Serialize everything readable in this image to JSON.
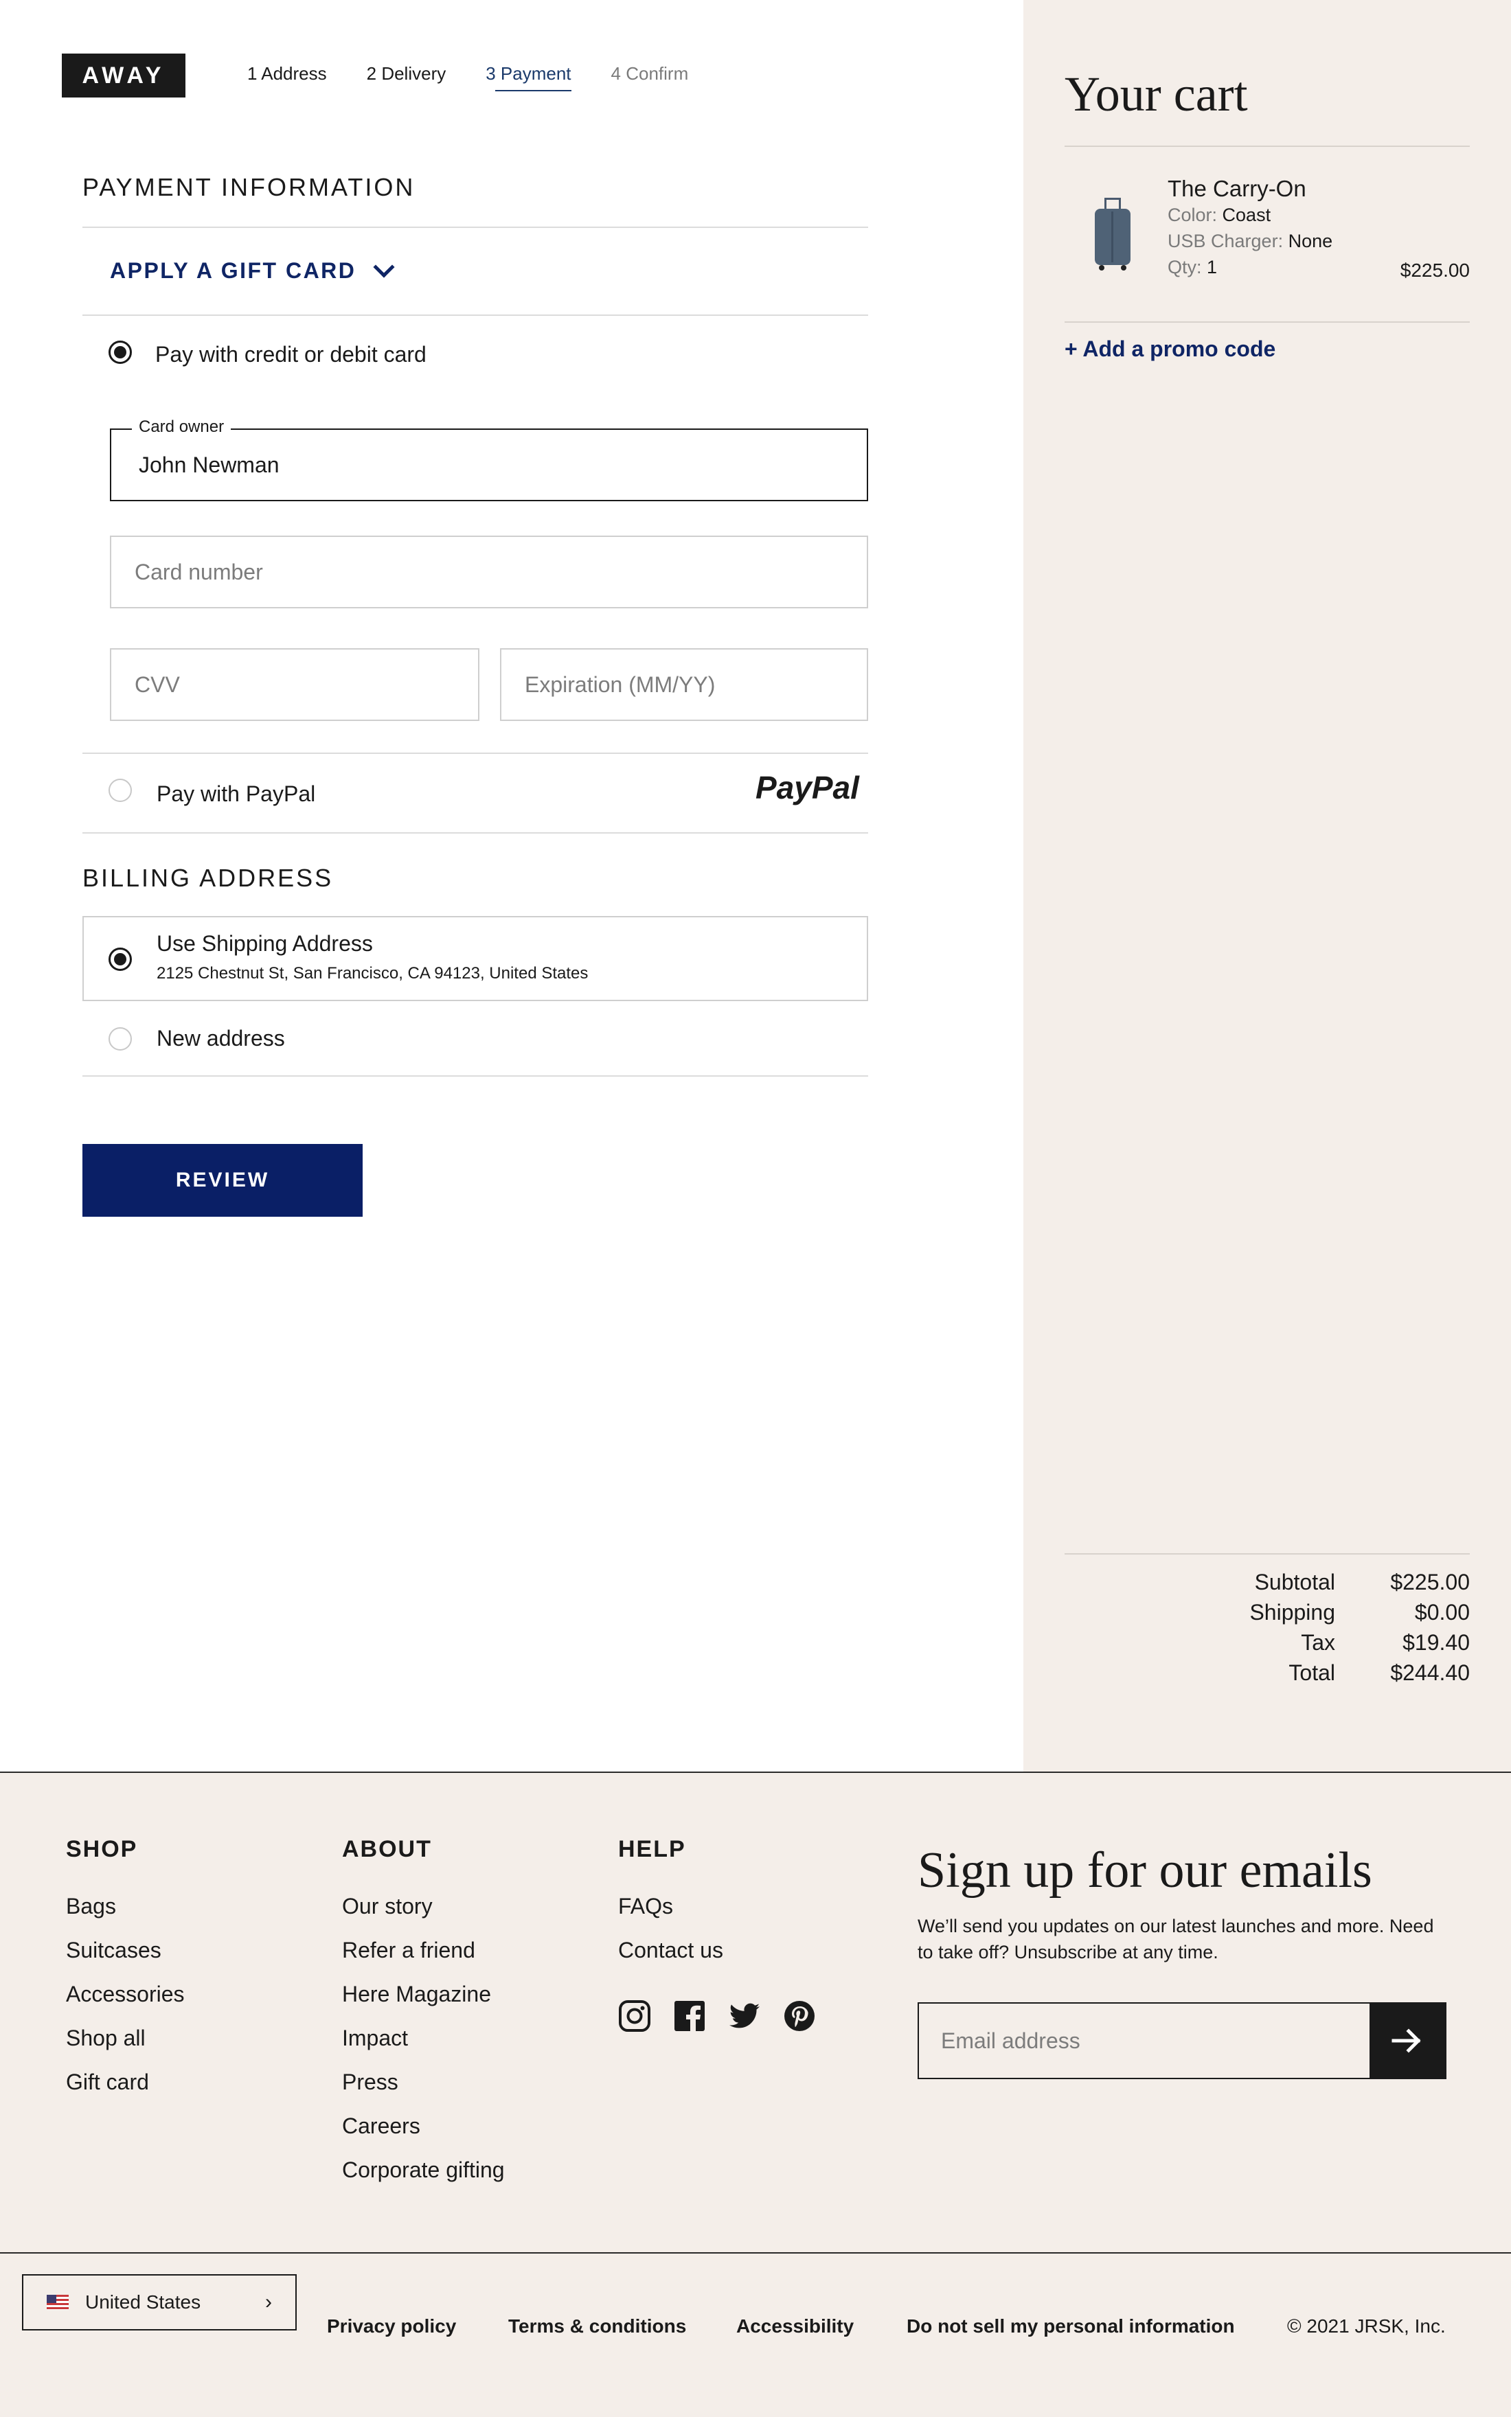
{
  "brand": {
    "logo": "AWAY"
  },
  "steps": [
    {
      "label": "1 Address",
      "state": "done"
    },
    {
      "label": "2 Delivery",
      "state": "done"
    },
    {
      "label": "3 Payment",
      "state": "active"
    },
    {
      "label": "4 Confirm",
      "state": "upcoming"
    }
  ],
  "payment": {
    "title": "PAYMENT INFORMATION",
    "gift_card_label": "APPLY A GIFT CARD",
    "credit_option": {
      "label": "Pay with credit or debit card",
      "selected": true
    },
    "card_owner": {
      "label": "Card owner",
      "value": "John Newman"
    },
    "card_number": {
      "placeholder": "Card number"
    },
    "cvv": {
      "placeholder": "CVV"
    },
    "expiration": {
      "placeholder": "Expiration (MM/YY)"
    },
    "paypal_option": {
      "label": "Pay with PayPal",
      "logo": "PayPal",
      "selected": false
    }
  },
  "billing": {
    "title": "BILLING ADDRESS",
    "shipping_option": {
      "label": "Use Shipping Address",
      "address": "2125 Chestnut St, San Francisco, CA 94123, United States",
      "selected": true
    },
    "new_option": {
      "label": "New address",
      "selected": false
    }
  },
  "review_button": "REVIEW",
  "cart": {
    "title": "Your cart",
    "item": {
      "name": "The Carry-On",
      "color_label": "Color:",
      "color_value": "Coast",
      "usb_label": "USB Charger:",
      "usb_value": "None",
      "qty_label": "Qty:",
      "qty_value": "1",
      "price": "$225.00"
    },
    "promo_link": "+ Add a promo code",
    "totals": [
      {
        "label": "Subtotal",
        "value": "$225.00"
      },
      {
        "label": "Shipping",
        "value": "$0.00"
      },
      {
        "label": "Tax",
        "value": "$19.40"
      },
      {
        "label": "Total",
        "value": "$244.40"
      }
    ]
  },
  "footer": {
    "shop": {
      "title": "SHOP",
      "links": [
        "Bags",
        "Suitcases",
        "Accessories",
        "Shop all",
        "Gift card"
      ]
    },
    "about": {
      "title": "ABOUT",
      "links": [
        "Our story",
        "Refer a friend",
        "Here Magazine",
        "Impact",
        "Press",
        "Careers",
        "Corporate gifting"
      ]
    },
    "help": {
      "title": "HELP",
      "links": [
        "FAQs",
        "Contact us"
      ]
    },
    "social_icons": [
      "instagram-icon",
      "facebook-icon",
      "twitter-icon",
      "pinterest-icon"
    ],
    "signup": {
      "title": "Sign up for our emails",
      "text": "We’ll send you updates on our latest launches and more. Need to take off? Unsubscribe at any time.",
      "email_placeholder": "Email address"
    },
    "country": "United States",
    "legal_links": [
      "Privacy policy",
      "Terms & conditions",
      "Accessibility",
      "Do not sell my personal information"
    ],
    "copyright": "© 2021 JRSK, Inc."
  },
  "colors": {
    "navy": "#0a1f66",
    "link_blue": "#0f2565",
    "cart_bg": "#f4eee9",
    "text": "#1a1a1a"
  }
}
